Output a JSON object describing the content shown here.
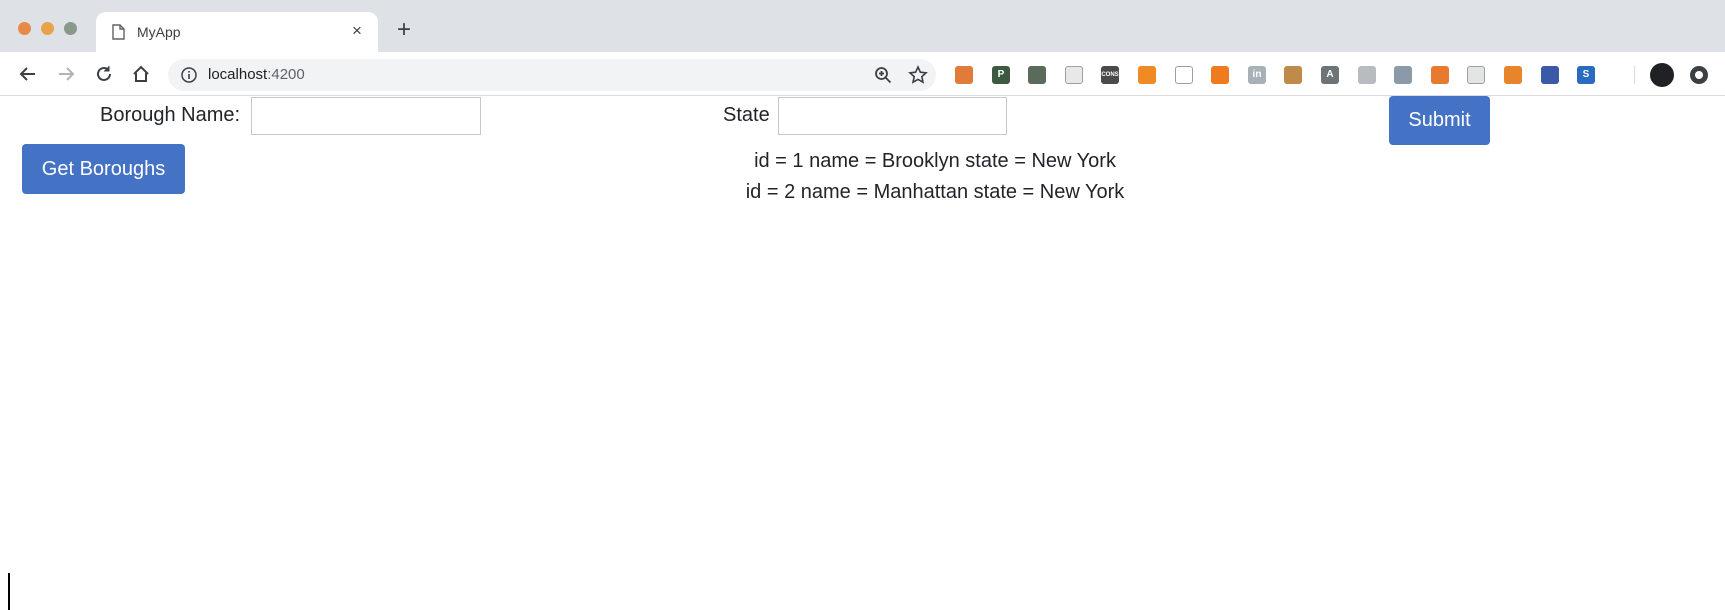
{
  "browser": {
    "tab": {
      "title": "MyApp",
      "close_glyph": "×",
      "icon": "page-icon"
    },
    "new_tab_glyph": "+",
    "address": {
      "host": "localhost",
      "port": ":4200"
    },
    "nav_icons": [
      "back-arrow-icon",
      "forward-arrow-icon",
      "reload-icon",
      "home-icon"
    ],
    "extensions": [
      {
        "name": "globe-ext-icon",
        "color": "#e07b39",
        "glyph": ""
      },
      {
        "name": "p-ext-icon",
        "color": "#3d5a40",
        "glyph": "P"
      },
      {
        "name": "leaf-ext-icon",
        "color": "#5b6b5b",
        "glyph": ""
      },
      {
        "name": "face-ext-icon",
        "color": "#e8e8e8",
        "glyph": ""
      },
      {
        "name": "cons-ext-icon",
        "color": "#4a4a4a",
        "glyph": "CONS"
      },
      {
        "name": "orange-ring-ext-icon",
        "color": "#f08a24",
        "glyph": ""
      },
      {
        "name": "cast-icon",
        "color": "#ffffff",
        "glyph": ""
      },
      {
        "name": "moon-ext-icon",
        "color": "#f07b1f",
        "glyph": ""
      },
      {
        "name": "in-ext-icon",
        "color": "#a8b0b8",
        "glyph": "in"
      },
      {
        "name": "android-ext-icon",
        "color": "#c08a4a",
        "glyph": ""
      },
      {
        "name": "angular-grey-ext-icon",
        "color": "#6e7377",
        "glyph": "A"
      },
      {
        "name": "window-ext-icon",
        "color": "#b8bcc0",
        "glyph": ""
      },
      {
        "name": "gear-ext-icon",
        "color": "#8a9aa8",
        "glyph": ""
      },
      {
        "name": "angular-ext-icon",
        "color": "#e87a30",
        "glyph": ""
      },
      {
        "name": "square-ext-icon",
        "color": "#e4e4e4",
        "glyph": ""
      },
      {
        "name": "target-ext-icon",
        "color": "#e8842a",
        "glyph": ""
      },
      {
        "name": "book-ext-icon",
        "color": "#3a5aa8",
        "glyph": ""
      },
      {
        "name": "s-ext-icon",
        "color": "#2a6ac0",
        "glyph": "S"
      }
    ]
  },
  "form": {
    "borough_label": "Borough Name:",
    "borough_value": "",
    "state_label": "State",
    "state_value": "",
    "submit_label": "Submit"
  },
  "get_boroughs_label": "Get Boroughs",
  "results": [
    "id = 1 name = Brooklyn state = New York",
    "id = 2 name = Manhattan state = New York"
  ],
  "colors": {
    "primary": "#4472c4"
  }
}
